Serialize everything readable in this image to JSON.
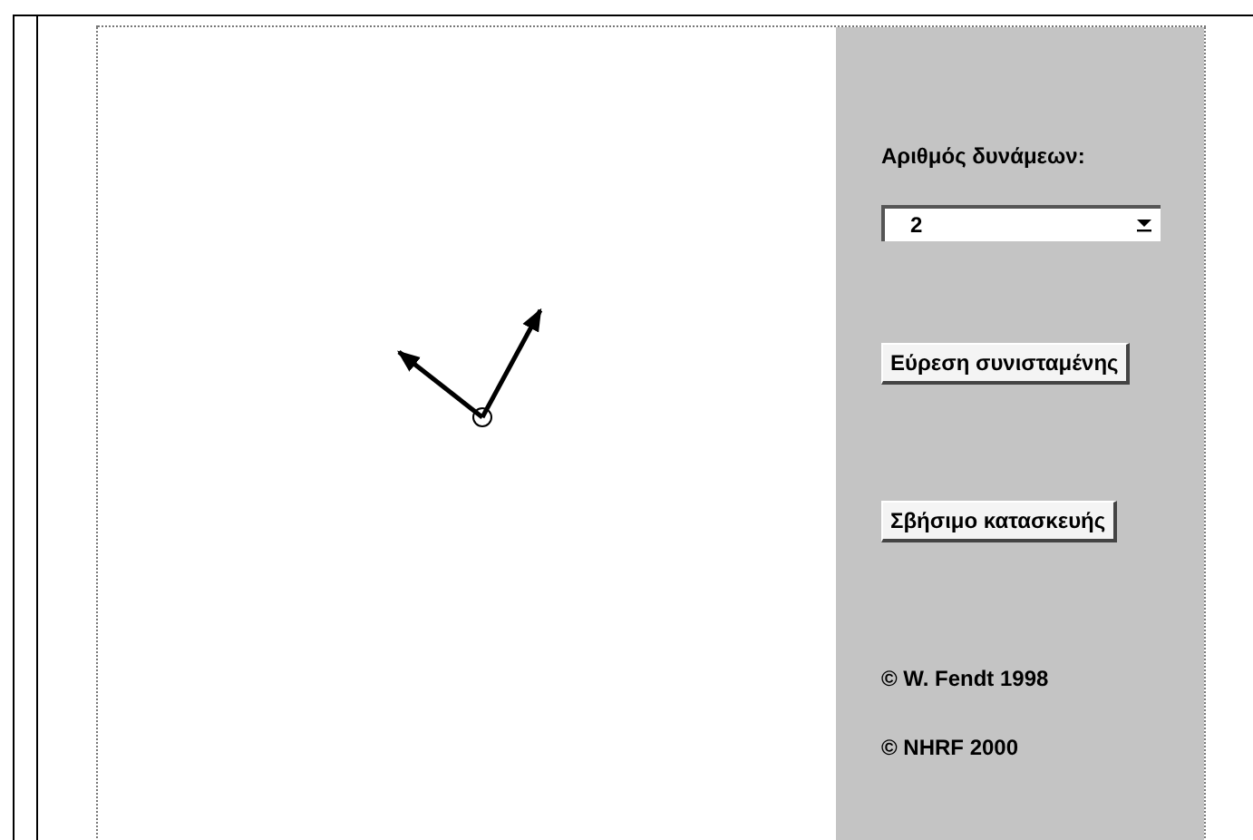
{
  "panel": {
    "label": "Αριθμός δυνάμεων:",
    "count_select": {
      "value": "2"
    },
    "buttons": [
      "Εύρεση συνισταμένης",
      "Σβήσιμο κατασκευής"
    ],
    "credits": [
      "© W. Fendt 1998",
      "© NHRF 2000"
    ]
  }
}
